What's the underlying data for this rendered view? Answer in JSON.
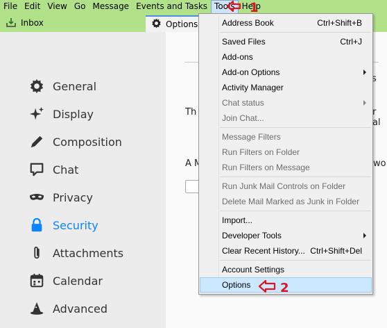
{
  "menubar": {
    "items": [
      "File",
      "Edit",
      "View",
      "Go",
      "Message",
      "Events and Tasks",
      "Tools",
      "Help"
    ]
  },
  "tabs": {
    "inbox": "Inbox",
    "options": "Options"
  },
  "sidebar": {
    "items": [
      {
        "label": "General",
        "icon": "gear-icon"
      },
      {
        "label": "Display",
        "icon": "sparkle-icon"
      },
      {
        "label": "Composition",
        "icon": "pencil-icon"
      },
      {
        "label": "Chat",
        "icon": "chat-icon"
      },
      {
        "label": "Privacy",
        "icon": "mask-icon"
      },
      {
        "label": "Security",
        "icon": "lock-icon",
        "selected": true
      },
      {
        "label": "Attachments",
        "icon": "paperclip-icon"
      },
      {
        "label": "Calendar",
        "icon": "calendar-icon"
      },
      {
        "label": "Advanced",
        "icon": "wizard-hat-icon"
      }
    ]
  },
  "main": {
    "fragment_1": "Th",
    "fragment_2": "r al",
    "fragment_3": "A M",
    "fragment_4": "wo",
    "fragment_5": "s"
  },
  "tools_menu": {
    "items": [
      {
        "label": "Address Book",
        "shortcut": "Ctrl+Shift+B",
        "disabled": false
      },
      {
        "label": "Saved Files",
        "shortcut": "Ctrl+J",
        "disabled": false
      },
      {
        "label": "Add-ons",
        "shortcut": "",
        "disabled": false
      },
      {
        "label": "Add-on Options",
        "shortcut": "",
        "submenu": true,
        "disabled": false
      },
      {
        "label": "Activity Manager",
        "shortcut": "",
        "disabled": false
      },
      {
        "label": "Chat status",
        "shortcut": "",
        "submenu": true,
        "disabled": true
      },
      {
        "label": "Join Chat...",
        "shortcut": "",
        "disabled": true
      },
      {
        "label": "Message Filters",
        "shortcut": "",
        "disabled": true
      },
      {
        "label": "Run Filters on Folder",
        "shortcut": "",
        "disabled": true
      },
      {
        "label": "Run Filters on Message",
        "shortcut": "",
        "disabled": true
      },
      {
        "label": "Run Junk Mail Controls on Folder",
        "shortcut": "",
        "disabled": true
      },
      {
        "label": "Delete Mail Marked as Junk in Folder",
        "shortcut": "",
        "disabled": true
      },
      {
        "label": "Import...",
        "shortcut": "",
        "disabled": false
      },
      {
        "label": "Developer Tools",
        "shortcut": "",
        "submenu": true,
        "disabled": false
      },
      {
        "label": "Clear Recent History...",
        "shortcut": "Ctrl+Shift+Del",
        "disabled": false
      },
      {
        "label": "Account Settings",
        "shortcut": "",
        "disabled": false
      },
      {
        "label": "Options",
        "shortcut": "",
        "disabled": false,
        "highlighted": true
      }
    ]
  },
  "annotations": {
    "step1": "1",
    "step2": "2"
  },
  "colors": {
    "menubar_bg": "#b1e28a",
    "accent": "#0a84ff",
    "annotation": "#e0141e",
    "menu_highlight": "#cce8ff"
  }
}
